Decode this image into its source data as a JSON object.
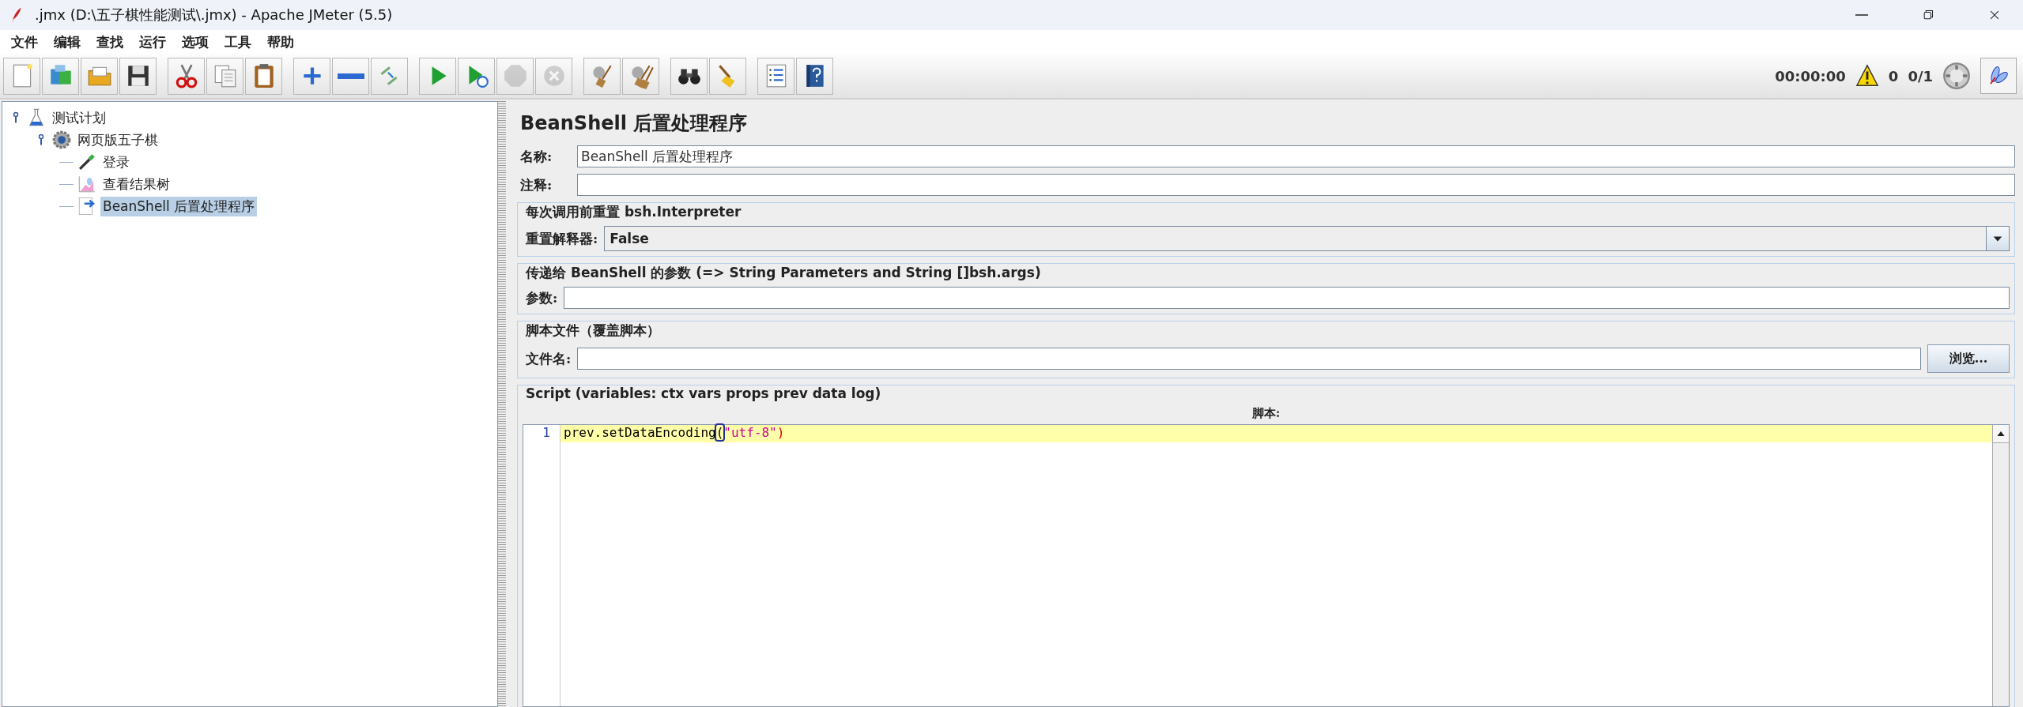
{
  "window": {
    "title": ".jmx (D:\\五子棋性能测试\\.jmx) - Apache JMeter (5.5)"
  },
  "menu": [
    "文件",
    "编辑",
    "查找",
    "运行",
    "选项",
    "工具",
    "帮助"
  ],
  "toolbar": {
    "groups": [
      [
        {
          "kind": "new",
          "disabled": false
        },
        {
          "kind": "templates",
          "disabled": false
        },
        {
          "kind": "open",
          "disabled": false
        },
        {
          "kind": "save",
          "disabled": false
        }
      ],
      [
        {
          "kind": "cut",
          "disabled": false
        },
        {
          "kind": "copy",
          "disabled": false
        },
        {
          "kind": "paste",
          "disabled": false
        }
      ],
      [
        {
          "kind": "expand",
          "disabled": false
        },
        {
          "kind": "collapse",
          "disabled": false
        },
        {
          "kind": "toggle",
          "disabled": false
        }
      ],
      [
        {
          "kind": "start",
          "disabled": false
        },
        {
          "kind": "start_no_pause",
          "disabled": false
        },
        {
          "kind": "stop",
          "disabled": true
        },
        {
          "kind": "shutdown",
          "disabled": true
        }
      ],
      [
        {
          "kind": "clear",
          "disabled": false
        },
        {
          "kind": "clear_all",
          "disabled": false
        }
      ],
      [
        {
          "kind": "search",
          "disabled": false
        },
        {
          "kind": "reset_search",
          "disabled": false
        }
      ],
      [
        {
          "kind": "functions",
          "disabled": false
        },
        {
          "kind": "help",
          "disabled": false
        }
      ]
    ],
    "timer": "00:00:00",
    "warnings": "0",
    "threads": "0/1"
  },
  "tree": [
    {
      "label": "测试计划",
      "kind": "plan",
      "expanded": true,
      "selected": false,
      "children": [
        {
          "label": "网页版五子棋",
          "kind": "thread_group",
          "expanded": true,
          "selected": false,
          "children": [
            {
              "label": "登录",
              "kind": "sampler",
              "selected": false
            },
            {
              "label": "查看结果树",
              "kind": "listener",
              "selected": false
            },
            {
              "label": "BeanShell 后置处理程序",
              "kind": "post_processor",
              "selected": true
            }
          ]
        }
      ]
    }
  ],
  "form": {
    "title": "BeanShell 后置处理程序",
    "name": {
      "label": "名称:",
      "value": "BeanShell 后置处理程序"
    },
    "comment": {
      "label": "注释:"
    },
    "reset_section": {
      "title": "每次调用前重置 bsh.Interpreter",
      "label": "重置解释器:",
      "value": "False"
    },
    "params_section": {
      "title": "传递给 BeanShell 的参数 (=> String Parameters and String []bsh.args)",
      "label": "参数:"
    },
    "file_section": {
      "title": "脚本文件（覆盖脚本）",
      "label": "文件名:",
      "button": "浏览..."
    },
    "script_section": {
      "title": "Script (variables: ctx vars props prev data log)",
      "label": "脚本:",
      "lines": [
        {
          "number": "1",
          "current": true,
          "tokens": [
            {
              "text": "prev.setDataEncoding",
              "kind": "plain",
              "bracket_match": false
            },
            {
              "text": "(",
              "kind": "plain",
              "bracket_match": true
            },
            {
              "text": "\"utf-8\"",
              "kind": "string",
              "bracket_match": false
            },
            {
              "text": ")",
              "kind": "paren",
              "bracket_match": false
            }
          ]
        }
      ]
    }
  }
}
